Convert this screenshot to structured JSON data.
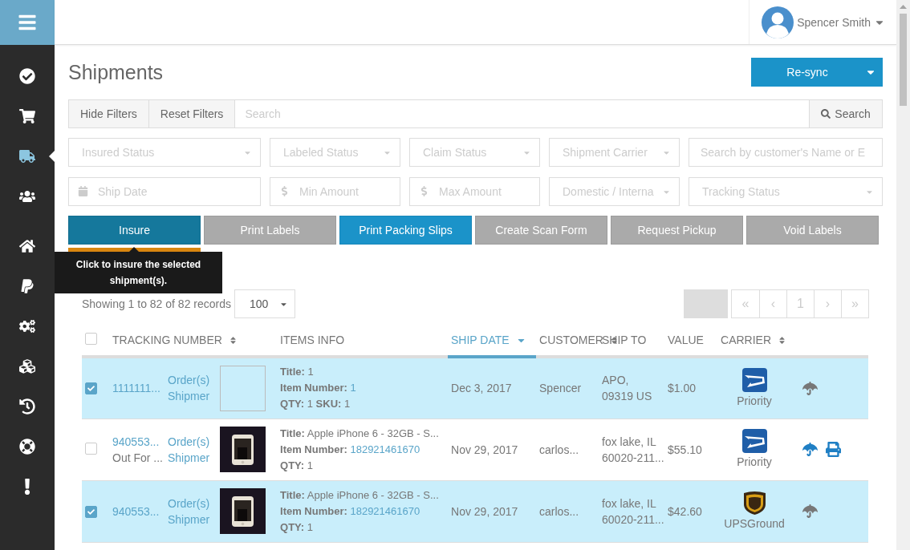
{
  "sidebar": {
    "items": [
      {
        "kind": "check",
        "selected": false
      },
      {
        "kind": "cart",
        "selected": false
      },
      {
        "kind": "truck",
        "selected": true
      },
      {
        "kind": "users",
        "selected": false
      },
      {
        "kind": "home",
        "selected": false
      },
      {
        "kind": "paypal",
        "selected": false
      },
      {
        "kind": "cogs",
        "selected": false
      },
      {
        "kind": "cubes",
        "selected": false
      },
      {
        "kind": "history",
        "selected": false
      },
      {
        "kind": "lifering",
        "selected": false
      },
      {
        "kind": "alert",
        "selected": false
      }
    ]
  },
  "header": {
    "user_name": "Spencer Smith"
  },
  "page": {
    "title": "Shipments",
    "resync_button": "Re-sync"
  },
  "search_bar": {
    "buttons": [
      "Hide Filters",
      "Reset Filters"
    ],
    "placeholder": "Search",
    "submit": "Search"
  },
  "filters": [
    {
      "kind": "select",
      "placeholder": "Insured Status"
    },
    {
      "kind": "select",
      "placeholder": "Labeled Status"
    },
    {
      "kind": "select",
      "placeholder": "Claim Status"
    },
    {
      "kind": "select",
      "placeholder": "Shipment Carrier"
    },
    {
      "kind": "input",
      "placeholder": "Search by customer's Name or E"
    },
    {
      "kind": "date",
      "placeholder": "Ship Date"
    },
    {
      "kind": "amount",
      "placeholder": "Min Amount"
    },
    {
      "kind": "amount",
      "placeholder": "Max Amount"
    },
    {
      "kind": "select",
      "placeholder": "Domestic / Interna"
    },
    {
      "kind": "select",
      "placeholder": "Tracking Status"
    }
  ],
  "actions": [
    {
      "label": "Insure",
      "kind": "insure"
    },
    {
      "label": "Print Labels",
      "kind": "muted"
    },
    {
      "label": "Print Packing Slips",
      "kind": "primary"
    },
    {
      "label": "Create Scan Form",
      "kind": "muted"
    },
    {
      "label": "Request Pickup",
      "kind": "muted"
    },
    {
      "label": "Void Labels",
      "kind": "muted"
    }
  ],
  "covered_button": {
    "kind": "danger"
  },
  "tooltip": "Click to insure the selected shipment(s).",
  "records": {
    "summary": "Showing 1 to 82 of 82 records",
    "page_size": "100"
  },
  "pagination": [
    "«",
    "‹",
    "1",
    "›",
    "»"
  ],
  "table": {
    "all_checked": false,
    "columns": [
      {
        "label": "TRACKING NUMBER",
        "sort": {
          "kind": "both"
        },
        "selected": false
      },
      {
        "label": "ITEMS INFO",
        "selected": false
      },
      {
        "label": "SHIP DATE",
        "sort": {
          "kind": "desc"
        },
        "selected": true
      },
      {
        "label": "CUSTOMER",
        "sort": {
          "kind": "both"
        },
        "selected": false
      },
      {
        "label": "SHIP TO",
        "selected": false
      },
      {
        "label": "VALUE",
        "selected": false
      },
      {
        "label": "CARRIER",
        "sort": {
          "kind": "both"
        },
        "selected": false
      }
    ],
    "rows": [
      {
        "selected": true,
        "tracking": "1111111...",
        "status": null,
        "order_link": "Order(s)",
        "shipment_link": "Shipmer",
        "image": {
          "kind": "empty"
        },
        "info": [
          [
            {
              "label": "Title:",
              "value": "1",
              "link": false
            }
          ],
          [
            {
              "label": "Item Number:",
              "value": "1",
              "link": true
            }
          ],
          [
            {
              "label": "QTY:",
              "value": "1",
              "link": false
            },
            {
              "label": "SKU:",
              "value": "1",
              "link": false
            }
          ]
        ],
        "ship_date": "Dec 3, 2017",
        "customer": "Spencer",
        "ship_to": [
          "APO,",
          "09319 US"
        ],
        "value": "$1.00",
        "carrier": {
          "kind": "usps",
          "service": "Priority"
        },
        "insured": false,
        "printable": false
      },
      {
        "selected": false,
        "tracking": "940553...",
        "status": "Out For ...",
        "order_link": "Order(s)",
        "shipment_link": "Shipmer",
        "image": {
          "kind": "picture"
        },
        "info": [
          [
            {
              "label": "Title:",
              "value": "Apple iPhone 6 - 32GB - S...",
              "link": false
            }
          ],
          [
            {
              "label": "Item Number:",
              "value": "182921461670",
              "link": true
            }
          ],
          [
            {
              "label": "QTY:",
              "value": "1",
              "link": false
            }
          ]
        ],
        "ship_date": "Nov 29, 2017",
        "customer": "carlos...",
        "ship_to": [
          "fox lake, IL",
          "60020-211..."
        ],
        "value": "$55.10",
        "carrier": {
          "kind": "usps",
          "service": "Priority"
        },
        "insured": true,
        "printable": true
      },
      {
        "selected": true,
        "tracking": "940553...",
        "status": null,
        "order_link": "Order(s)",
        "shipment_link": "Shipmer",
        "image": {
          "kind": "picture"
        },
        "info": [
          [
            {
              "label": "Title:",
              "value": "Apple iPhone 6 - 32GB - S...",
              "link": false
            }
          ],
          [
            {
              "label": "Item Number:",
              "value": "182921461670",
              "link": true
            }
          ],
          [
            {
              "label": "QTY:",
              "value": "1",
              "link": false
            }
          ]
        ],
        "ship_date": "Nov 29, 2017",
        "customer": "carlos...",
        "ship_to": [
          "fox lake, IL",
          "60020-211..."
        ],
        "value": "$42.60",
        "carrier": {
          "kind": "ups",
          "service": "UPSGround"
        },
        "insured": false,
        "printable": false
      }
    ]
  }
}
